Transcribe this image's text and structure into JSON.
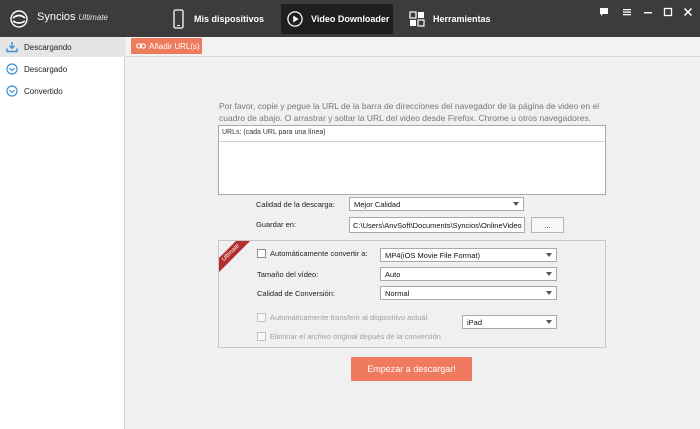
{
  "app": {
    "name": "Syncios",
    "edition": "Ultimate"
  },
  "nav": {
    "tabs": [
      {
        "label": "Mis dispositivos",
        "icon": "phone-icon"
      },
      {
        "label": "Video Downloader",
        "icon": "play-circle-icon",
        "active": true
      },
      {
        "label": "Herramientas",
        "icon": "grid-icon"
      }
    ]
  },
  "window_controls": [
    "chat-icon",
    "menu-icon",
    "minimize-icon",
    "maximize-icon",
    "close-icon"
  ],
  "sidebar": {
    "items": [
      {
        "label": "Descargando",
        "icon": "download-tray-icon",
        "active": true
      },
      {
        "label": "Descargado",
        "icon": "check-circle-icon"
      },
      {
        "label": "Convertido",
        "icon": "check-circle-icon"
      }
    ]
  },
  "toolbar": {
    "add_url_label": "Añadir URL(s)"
  },
  "main": {
    "instructions": "Por favor, copie y pegue la URL de la barra de direcciones del navegador de la página de video en el cuadro de abajo. O arrastrar y soltar la URL del video desde Firefox. Chrome u otros navegadores.",
    "url_box_label": "URLs: (cada URL para una línea)",
    "quality_label": "Calidad de la descarga:",
    "quality_value": "Mejor Calidad",
    "save_label": "Guardar en:",
    "save_path": "C:\\Users\\AnvSoft\\Documents\\Syncios\\OnlineVideo",
    "browse_label": "...",
    "ribbon": "Ultimate",
    "auto_convert_label": "Automáticamente convertir a:",
    "format_value": "MP4(iOS Movie File Format)",
    "size_label": "Tamaño del vídeo:",
    "size_value": "Auto",
    "conv_quality_label": "Calidad de Conversión:",
    "conv_quality_value": "Normal",
    "auto_transfer_label": "Automáticamente transferir al dispositivo actual",
    "device_value": "iPad",
    "delete_label": "Eliminar el archivo original depués de la conversión",
    "start_label": "Empezar a descargar!"
  },
  "colors": {
    "titlebar": "#3c3c3c",
    "accent": "#ef7a5d",
    "ribbon": "#b12f2f",
    "icon_blue": "#3a8fd6"
  }
}
